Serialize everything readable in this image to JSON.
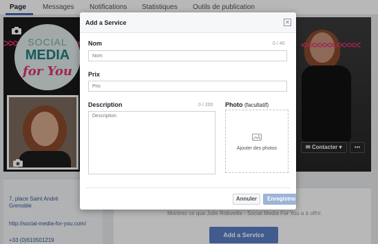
{
  "tabs": [
    {
      "label": "Page",
      "active": true
    },
    {
      "label": "Messages",
      "active": false
    },
    {
      "label": "Notifications",
      "active": false
    },
    {
      "label": "Statistiques",
      "active": false
    },
    {
      "label": "Outils de publication",
      "active": false
    }
  ],
  "cover": {
    "logo_line1": "SOCIAL",
    "logo_line2": "MEDIA",
    "logo_line3": "for You",
    "contact_button": "Contacter ▾",
    "more_button": "•••"
  },
  "sidebar": {
    "address_line1": "7, place Saint André",
    "address_line2": "Grenoble",
    "url": "http://social-media-for-you.com/",
    "phone": "+33 (0)610501219"
  },
  "services_panel": {
    "prompt": "Montrez ce que Julie Robveille - Social Media For You a à offrir.",
    "add_button": "Add a Service"
  },
  "modal": {
    "title": "Add a Service",
    "name_label": "Nom",
    "name_counter": "0 / 40",
    "name_placeholder": "Nom",
    "price_label": "Prix",
    "price_placeholder": "Prix",
    "description_label": "Description",
    "description_counter": "0 / 200",
    "description_placeholder": "Description",
    "photo_label": "Photo",
    "photo_optional": "(facultatif)",
    "photo_add": "Ajouter des photos",
    "cancel_button": "Annuler",
    "save_button": "Enregistrer"
  },
  "colors": {
    "accent_blue": "#4267b2",
    "brand_pink": "#e0336f",
    "brand_teal": "#1f7e80"
  }
}
